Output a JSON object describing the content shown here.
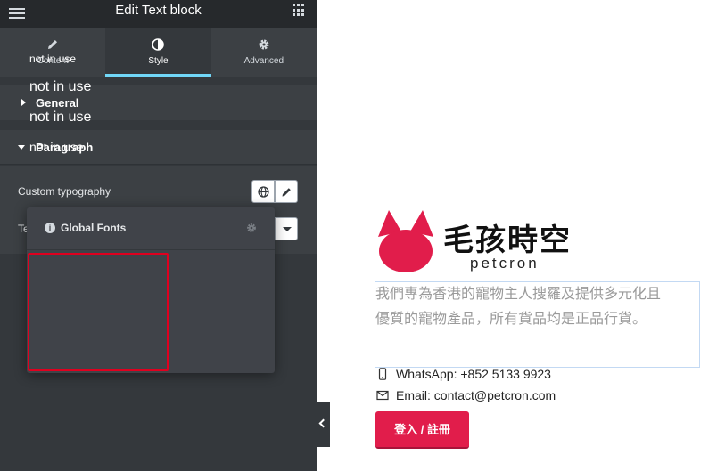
{
  "header": {
    "title": "Edit Text block"
  },
  "tabs": [
    {
      "label": "Content",
      "icon": "pencil-icon",
      "active": false
    },
    {
      "label": "Style",
      "icon": "contrast-icon",
      "active": true
    },
    {
      "label": "Advanced",
      "icon": "gear-icon",
      "active": false
    }
  ],
  "sections": {
    "general": "General",
    "paragraph": "Paragraph"
  },
  "controls": {
    "custom_typography": "Custom typography",
    "text_label_partial": "Te"
  },
  "global_fonts": {
    "title": "Global Fonts",
    "items": [
      "not in use",
      "not in use",
      "not in use",
      "not in use"
    ]
  },
  "preview": {
    "logo_text": "毛孩時空",
    "logo_sub": "petcron",
    "paragraph_lines": [
      "我們專為香港的寵物主人搜羅及提供多元化且",
      "優質的寵物產品，所有貨品均是正品行貨。"
    ],
    "whatsapp": "WhatsApp: +852 5133 9923",
    "email": "Email: contact@petcron.com",
    "login_button": "登入 / 註冊"
  },
  "colors": {
    "panel_bg": "#34383c",
    "tab_accent": "#71d7f7",
    "brand": "#e11d4b",
    "highlight_border": "#e0001f"
  }
}
